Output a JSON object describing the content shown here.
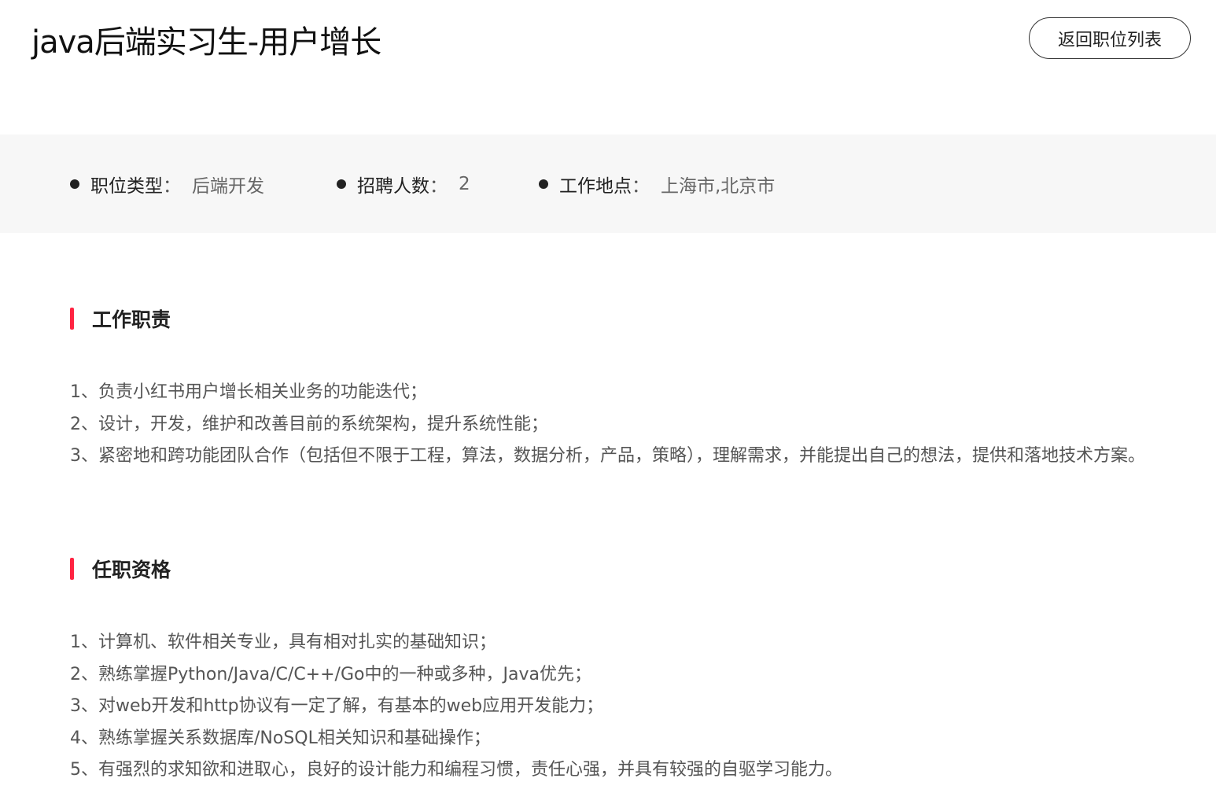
{
  "header": {
    "title": "java后端实习生-用户增长",
    "back_label": "返回职位列表"
  },
  "meta": {
    "items": [
      {
        "label": "职位类型",
        "separator": "：",
        "value": "后端开发"
      },
      {
        "label": "招聘人数",
        "separator": "：",
        "value": "2"
      },
      {
        "label": "工作地点",
        "separator": "：",
        "value": "上海市,北京市"
      }
    ]
  },
  "responsibilities": {
    "title": "工作职责",
    "items": [
      "1、负责小红书用户增长相关业务的功能迭代；",
      "2、设计，开发，维护和改善目前的系统架构，提升系统性能；",
      "3、紧密地和跨功能团队合作（包括但不限于工程，算法，数据分析，产品，策略），理解需求，并能提出自己的想法，提供和落地技术方案。"
    ]
  },
  "requirements": {
    "title": "任职资格",
    "items": [
      "1、计算机、软件相关专业，具有相对扎实的基础知识；",
      "2、熟练掌握Python/Java/C/C++/Go中的一种或多种，Java优先；",
      "3、对web开发和http协议有一定了解，有基本的web应用开发能力；",
      "4、熟练掌握关系数据库/NoSQL相关知识和基础操作；",
      "5、有强烈的求知欲和进取心，良好的设计能力和编程习惯，责任心强，并具有较强的自驱学习能力。"
    ]
  },
  "colors": {
    "accent": "#ff2442",
    "meta_background": "#f7f7f7"
  }
}
